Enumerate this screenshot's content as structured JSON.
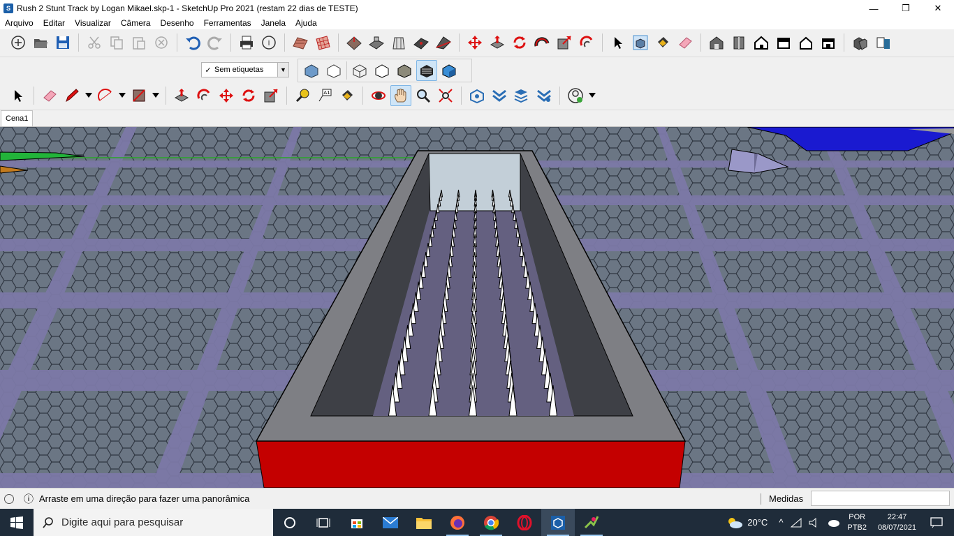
{
  "window": {
    "title": "Rush 2 Stunt Track by Logan Mikael.skp-1 - SketchUp Pro 2021 (restam 22 dias de TESTE)",
    "app_icon_letter": "S",
    "controls": {
      "minimize": "—",
      "maximize": "❐",
      "close": "✕"
    }
  },
  "menu": {
    "items": [
      "Arquivo",
      "Editar",
      "Visualizar",
      "Câmera",
      "Desenho",
      "Ferramentas",
      "Janela",
      "Ajuda"
    ]
  },
  "tags": {
    "selected": "Sem etiquetas",
    "check": "✓",
    "arrow": "▼"
  },
  "scenes": {
    "tabs": [
      "Cena1"
    ]
  },
  "status": {
    "help_icon": "ⓘ",
    "message": "Arraste em uma direção para fazer uma panorâmica",
    "measure_label": "Medidas",
    "measure_value": ""
  },
  "taskbar": {
    "search_placeholder": "Digite aqui para pesquisar",
    "weather": "20°C",
    "language": "POR",
    "language_sub": "PTB2",
    "time": "22:47",
    "date": "08/07/2021"
  },
  "colors": {
    "trench_red": "#c40000",
    "rim_gray": "#7e7f84",
    "wall_dark": "#3e4046",
    "floor_purple": "#646080",
    "back_wall": "#c3cfd8",
    "ground_hex": "#6b7684",
    "ground_stripe": "#7c79a7"
  }
}
